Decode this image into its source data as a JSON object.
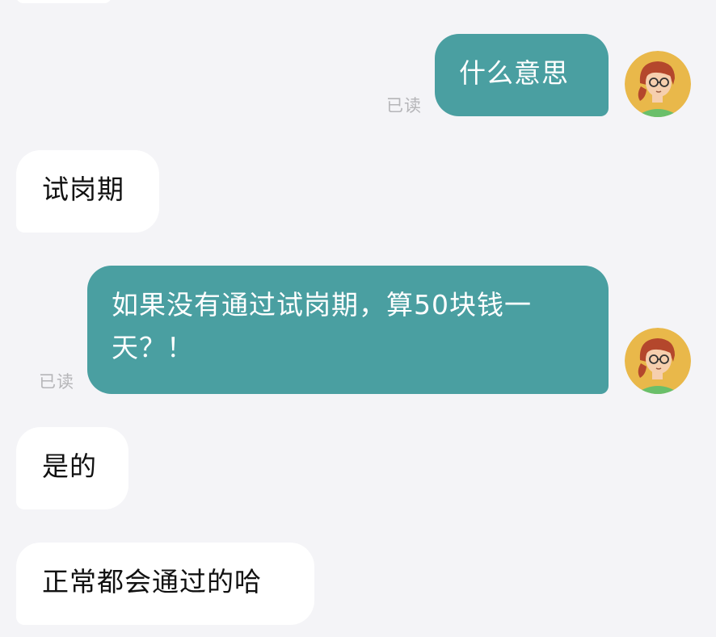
{
  "theme": {
    "background": "#f4f4f7",
    "outgoing_bubble": "#4a9fa1",
    "incoming_bubble": "#ffffff",
    "read_color": "#b5b5b8",
    "avatar_bg": "#e9b84a"
  },
  "messages": [
    {
      "direction": "outgoing",
      "text": "什么意思",
      "status": "已读",
      "avatar": "user-avatar-icon"
    },
    {
      "direction": "incoming",
      "text": "试岗期"
    },
    {
      "direction": "outgoing",
      "text": "如果没有通过试岗期，算50块钱一天？！",
      "status": "已读",
      "avatar": "user-avatar-icon"
    },
    {
      "direction": "incoming",
      "text": "是的"
    },
    {
      "direction": "incoming",
      "text": "正常都会通过的哈"
    }
  ]
}
